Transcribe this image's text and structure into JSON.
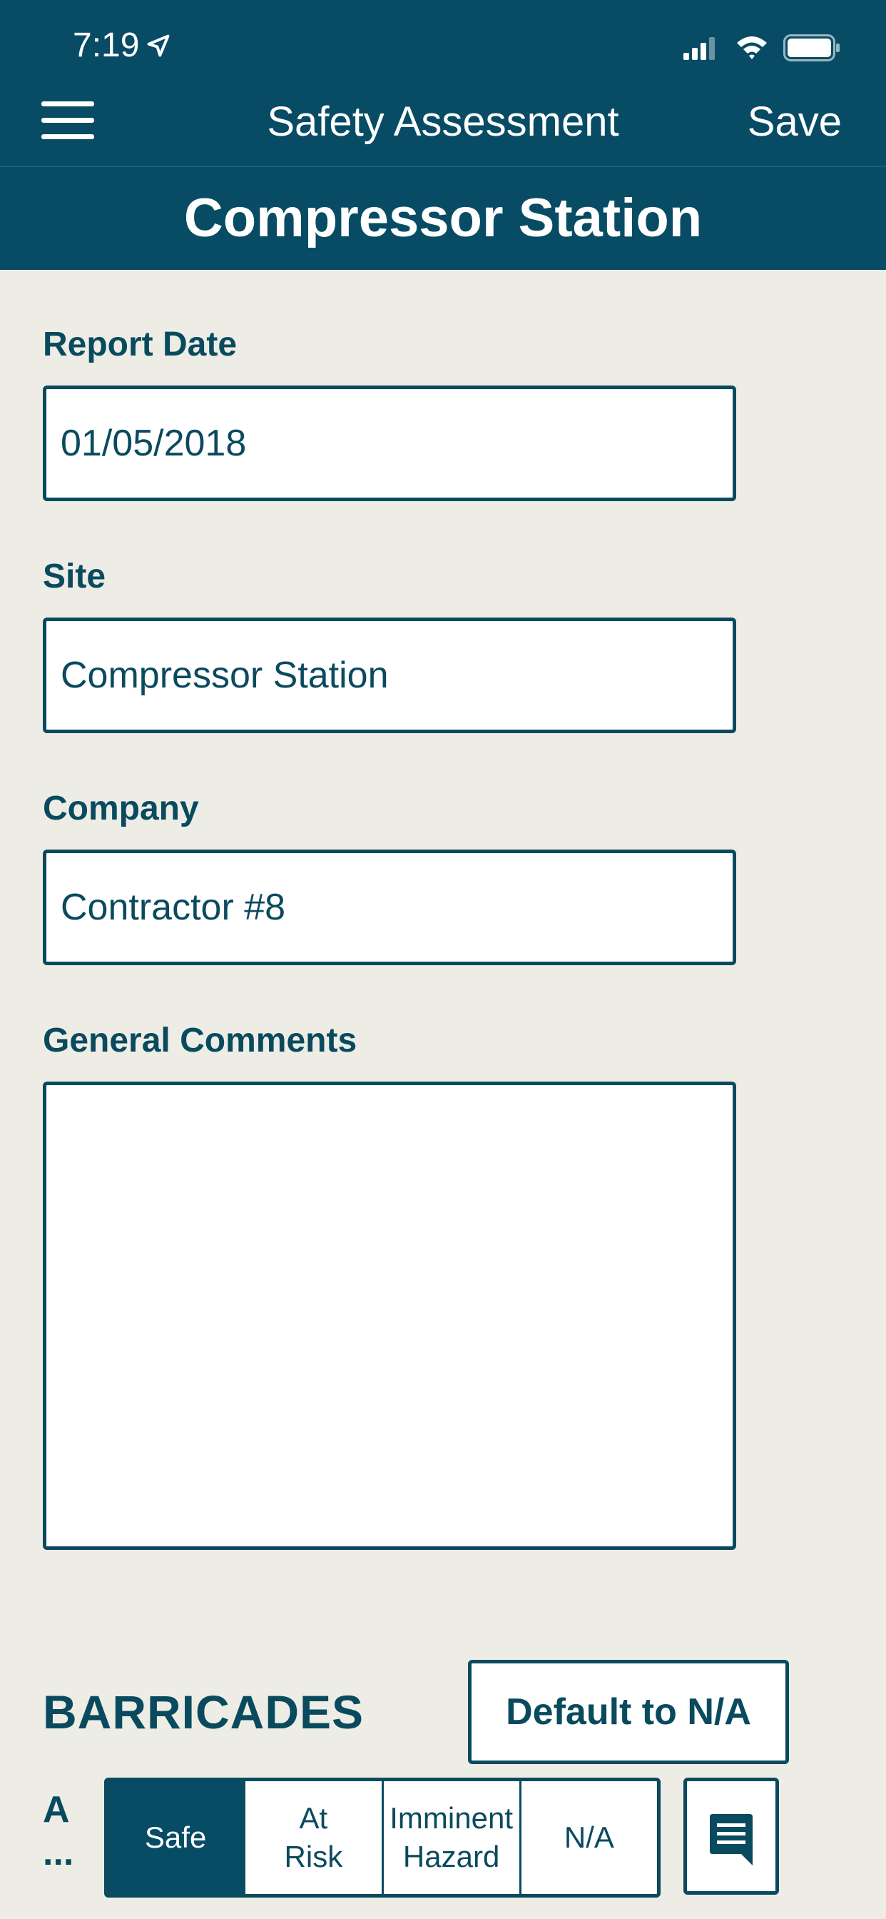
{
  "status_bar": {
    "time": "7:19"
  },
  "nav": {
    "title": "Safety Assessment",
    "save_label": "Save"
  },
  "subheader": {
    "title": "Compressor Station"
  },
  "form": {
    "report_date": {
      "label": "Report Date",
      "value": "01/05/2018"
    },
    "site": {
      "label": "Site",
      "value": "Compressor Station"
    },
    "company": {
      "label": "Company",
      "value": "Contractor #8"
    },
    "general_comments": {
      "label": "General Comments",
      "value": ""
    }
  },
  "section": {
    "title": "BARRICADES",
    "default_button_label": "Default to N/A",
    "row": {
      "label_line1": "A",
      "label_line2": "...",
      "options": [
        {
          "label": "Safe"
        },
        {
          "label_line1": "At",
          "label_line2": "Risk"
        },
        {
          "label_line1": "Imminent",
          "label_line2": "Hazard"
        },
        {
          "label": "N/A"
        }
      ],
      "selected": "Safe"
    }
  },
  "colors": {
    "header_bg": "#074C64",
    "text_primary": "#0A4A5E",
    "page_bg": "#EDEDE6",
    "field_bg": "#FFFFFF"
  },
  "icons": {
    "menu": "hamburger-menu-icon",
    "location": "location-arrow-icon",
    "signal": "cellular-signal-icon",
    "wifi": "wifi-icon",
    "battery": "battery-icon",
    "comment": "comment-icon"
  }
}
